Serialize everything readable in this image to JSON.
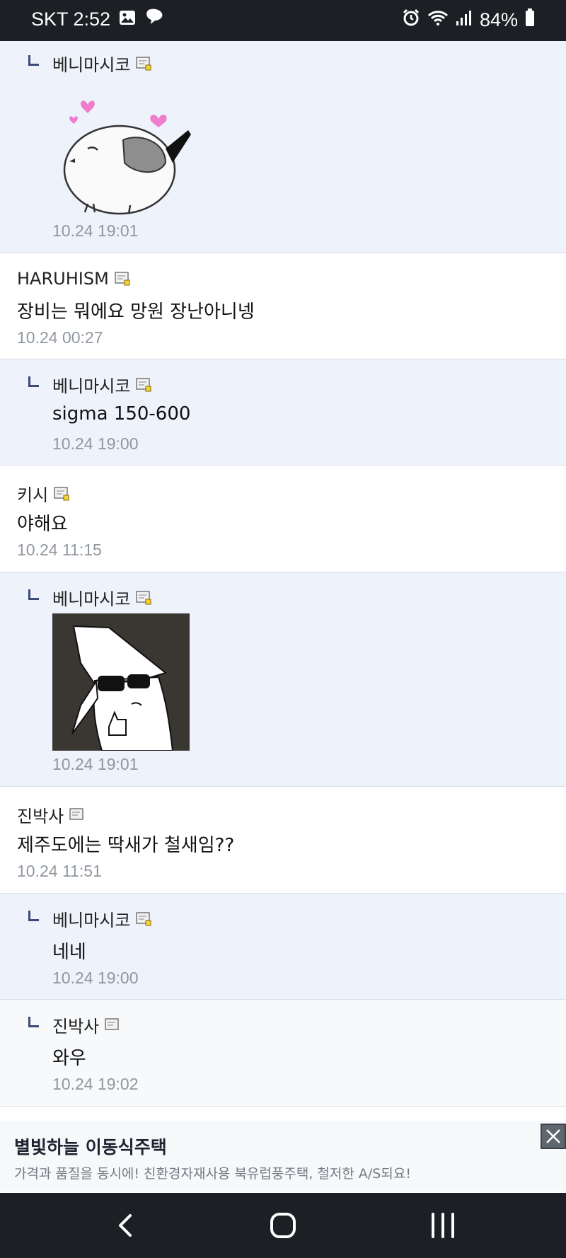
{
  "status_bar": {
    "carrier_time": "SKT 2:52",
    "battery": "84%",
    "left_icons": [
      "gallery-icon",
      "chat-bubble-icon"
    ],
    "right_icons": [
      "alarm-icon",
      "wifi-icon",
      "signal-icon",
      "battery-icon"
    ]
  },
  "comments": [
    {
      "type": "reply",
      "author": "베니마시코",
      "sticker": "bird-sticker",
      "time": "10.24 19:01"
    },
    {
      "type": "comment",
      "author": "HARUHISM",
      "text": "장비는 뭐에요 망원 장난아니넹",
      "time": "10.24 00:27"
    },
    {
      "type": "reply",
      "author": "베니마시코",
      "text": "sigma 150-600",
      "time": "10.24 19:00"
    },
    {
      "type": "comment",
      "author": "키시",
      "text": "야해요",
      "time": "10.24 11:15"
    },
    {
      "type": "reply",
      "author": "베니마시코",
      "sticker": "sunglasses-wizard-sticker",
      "time": "10.24 19:01"
    },
    {
      "type": "comment",
      "author": "진박사",
      "text": "제주도에는 딱새가 철새임??",
      "time": "10.24 11:51"
    },
    {
      "type": "reply",
      "author": "베니마시코",
      "text": "네네",
      "time": "10.24 19:00"
    },
    {
      "type": "reply",
      "author": "진박사",
      "text": "와우",
      "time": "10.24 19:02"
    }
  ],
  "ad": {
    "title": "별빛하늘 이동식주택",
    "description": "가격과 품질을 동시에! 친환경자재사용 북유럽풍주택, 철저한 A/S되요!",
    "close_icon": "close-icon"
  },
  "nav_bar": {
    "icons": [
      "back-icon",
      "home-icon",
      "recents-icon"
    ]
  },
  "colors": {
    "status_bar_bg": "#1c1f24",
    "reply_bg": "#edf2fb",
    "reply_mark": "#3c4a78",
    "time_text": "#9097a0"
  }
}
